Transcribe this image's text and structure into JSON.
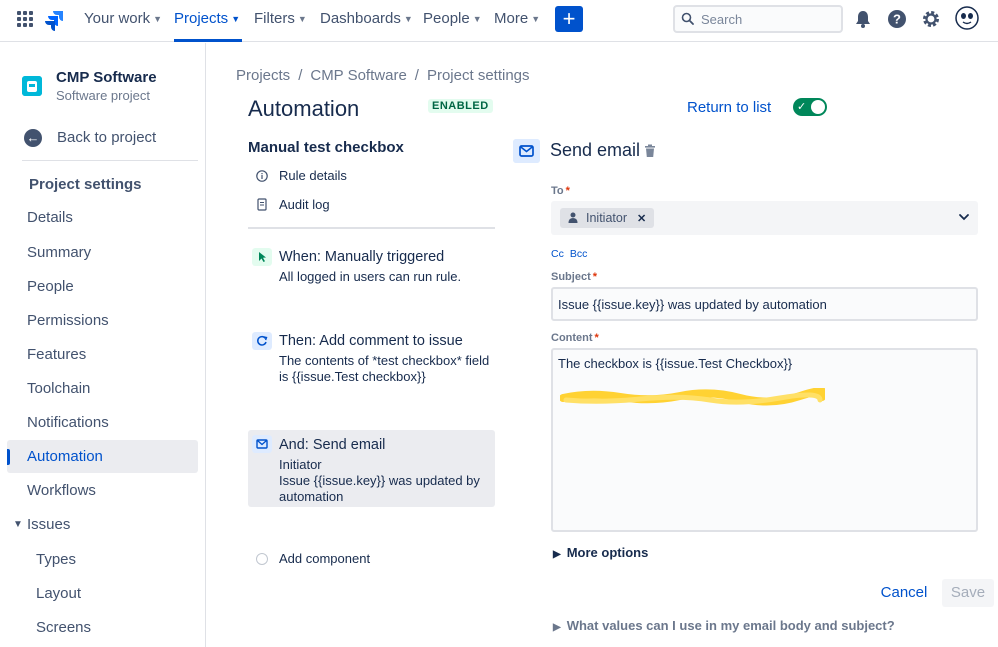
{
  "nav": {
    "items": [
      {
        "label": "Your work",
        "chevron": true
      },
      {
        "label": "Projects",
        "chevron": true,
        "active": true
      },
      {
        "label": "Filters",
        "chevron": true
      },
      {
        "label": "Dashboards",
        "chevron": true
      },
      {
        "label": "People",
        "chevron": true
      },
      {
        "label": "More",
        "chevron": true
      }
    ],
    "create_label": "+",
    "search_placeholder": "Search",
    "icons": [
      "app-switcher-icon",
      "jira-logo-icon",
      "notifications-icon",
      "help-icon",
      "settings-icon",
      "user-avatar-icon"
    ]
  },
  "sidebar": {
    "project_name": "CMP Software",
    "project_type": "Software project",
    "back_label": "Back to project",
    "heading": "Project settings",
    "items": [
      {
        "label": "Details"
      },
      {
        "label": "Summary"
      },
      {
        "label": "People"
      },
      {
        "label": "Permissions"
      },
      {
        "label": "Features"
      },
      {
        "label": "Toolchain"
      },
      {
        "label": "Notifications"
      },
      {
        "label": "Automation",
        "active": true
      },
      {
        "label": "Workflows"
      },
      {
        "label": "Issues",
        "expandable": true
      },
      {
        "label": "Types",
        "sub": true
      },
      {
        "label": "Layout",
        "sub": true
      },
      {
        "label": "Screens",
        "sub": true
      }
    ]
  },
  "breadcrumb": {
    "items": [
      "Projects",
      "CMP Software",
      "Project settings"
    ],
    "separator": "/"
  },
  "page": {
    "title": "Automation",
    "status_badge": "ENABLED",
    "return_label": "Return to list",
    "toggle_on": true
  },
  "rule": {
    "name": "Manual test checkbox",
    "links": {
      "details": "Rule details",
      "audit": "Audit log"
    },
    "steps": [
      {
        "title": "When: Manually triggered",
        "desc": "All logged in users can run rule.",
        "color": "#e3fcef",
        "icon": "cursor-trigger-icon"
      },
      {
        "title": "Then: Add comment to issue",
        "desc": "The contents of *test checkbox* field is {{issue.Test checkbox}}",
        "color": "#deebff",
        "icon": "comment-action-icon"
      },
      {
        "title": "And: Send email",
        "desc": "Initiator\nIssue {{issue.key}} was updated by automation",
        "color": "#deebff",
        "icon": "email-action-icon",
        "selected": true
      }
    ],
    "add_component": "Add component"
  },
  "form": {
    "title": "Send email",
    "to_label": "To",
    "to_chip": "Initiator",
    "cc_label": "Cc",
    "bcc_label": "Bcc",
    "subject_label": "Subject",
    "subject_value": "Issue {{issue.key}} was updated by automation",
    "content_label": "Content",
    "content_value": "The checkbox is {{issue.Test Checkbox}}",
    "more_options": "More options",
    "cancel": "Cancel",
    "save": "Save",
    "help": "What values can I use in my email body and subject?"
  },
  "colors": {
    "accent": "#0052cc",
    "success": "#00875a",
    "required": "#de350b",
    "highlight": "#ffd233"
  }
}
